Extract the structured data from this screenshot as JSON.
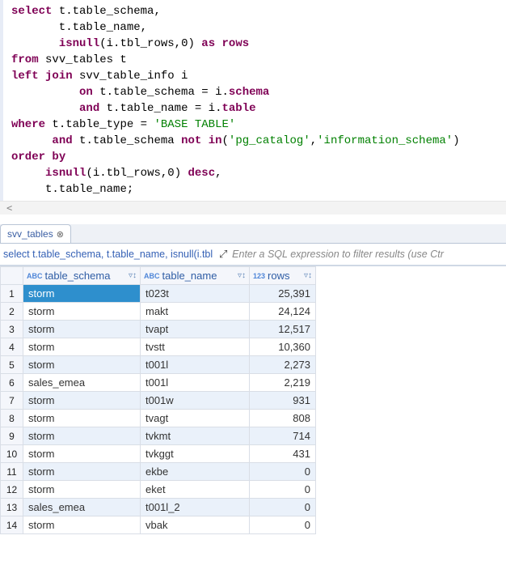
{
  "sql_tokens": [
    [
      [
        "kw",
        "select"
      ],
      [
        "pun",
        " t"
      ],
      [
        "pun",
        "."
      ],
      [
        "ident",
        "table_schema"
      ],
      [
        "pun",
        ","
      ]
    ],
    [
      [
        "pun",
        "       t"
      ],
      [
        "pun",
        "."
      ],
      [
        "ident",
        "table_name"
      ],
      [
        "pun",
        ","
      ]
    ],
    [
      [
        "pun",
        "       "
      ],
      [
        "kw",
        "isnull"
      ],
      [
        "pun",
        "(i"
      ],
      [
        "pun",
        "."
      ],
      [
        "ident",
        "tbl_rows"
      ],
      [
        "pun",
        ","
      ],
      [
        "num",
        "0"
      ],
      [
        "pun",
        ") "
      ],
      [
        "kw",
        "as"
      ],
      [
        "pun",
        " "
      ],
      [
        "kw",
        "rows"
      ]
    ],
    [
      [
        "kw",
        "from"
      ],
      [
        "pun",
        " svv_tables t"
      ]
    ],
    [
      [
        "kw",
        "left"
      ],
      [
        "pun",
        " "
      ],
      [
        "kw",
        "join"
      ],
      [
        "pun",
        " svv_table_info i"
      ]
    ],
    [
      [
        "pun",
        "          "
      ],
      [
        "kw",
        "on"
      ],
      [
        "pun",
        " t"
      ],
      [
        "pun",
        "."
      ],
      [
        "ident",
        "table_schema "
      ],
      [
        "pun",
        "= i"
      ],
      [
        "pun",
        "."
      ],
      [
        "kw",
        "schema"
      ]
    ],
    [
      [
        "pun",
        "          "
      ],
      [
        "kw",
        "and"
      ],
      [
        "pun",
        " t"
      ],
      [
        "pun",
        "."
      ],
      [
        "ident",
        "table_name "
      ],
      [
        "pun",
        "= i"
      ],
      [
        "pun",
        "."
      ],
      [
        "kw",
        "table"
      ]
    ],
    [
      [
        "kw",
        "where"
      ],
      [
        "pun",
        " t"
      ],
      [
        "pun",
        "."
      ],
      [
        "ident",
        "table_type "
      ],
      [
        "pun",
        "= "
      ],
      [
        "str",
        "'BASE TABLE'"
      ]
    ],
    [
      [
        "pun",
        "      "
      ],
      [
        "kw",
        "and"
      ],
      [
        "pun",
        " t"
      ],
      [
        "pun",
        "."
      ],
      [
        "ident",
        "table_schema "
      ],
      [
        "kw",
        "not"
      ],
      [
        "pun",
        " "
      ],
      [
        "kw",
        "in"
      ],
      [
        "pun",
        "("
      ],
      [
        "str",
        "'pg_catalog'"
      ],
      [
        "pun",
        ","
      ],
      [
        "str",
        "'information_schema'"
      ],
      [
        "pun",
        ")"
      ]
    ],
    [
      [
        "kw",
        "order"
      ],
      [
        "pun",
        " "
      ],
      [
        "kw",
        "by"
      ]
    ],
    [
      [
        "pun",
        "     "
      ],
      [
        "kw",
        "isnull"
      ],
      [
        "pun",
        "(i"
      ],
      [
        "pun",
        "."
      ],
      [
        "ident",
        "tbl_rows"
      ],
      [
        "pun",
        ","
      ],
      [
        "num",
        "0"
      ],
      [
        "pun",
        ") "
      ],
      [
        "kw",
        "desc"
      ],
      [
        "pun",
        ","
      ]
    ],
    [
      [
        "pun",
        "     t"
      ],
      [
        "pun",
        "."
      ],
      [
        "ident",
        "table_name"
      ],
      [
        "pun",
        ";"
      ]
    ]
  ],
  "tab": {
    "label": "svv_tables",
    "close_glyph": "⊗"
  },
  "filter_row": {
    "query_preview": "select t.table_schema, t.table_name, isnull(i.tbl",
    "expand_glyph": "⤢",
    "placeholder": "Enter a SQL expression to filter results (use Ctr"
  },
  "columns": [
    {
      "name": "table_schema",
      "type": "ABC",
      "type2": ""
    },
    {
      "name": "table_name",
      "type": "ABC",
      "type2": ""
    },
    {
      "name": "rows",
      "type": "123",
      "type2": ""
    }
  ],
  "chart_data": {
    "type": "table",
    "columns": [
      "table_schema",
      "table_name",
      "rows"
    ],
    "rows": [
      [
        "storm",
        "t023t",
        "25,391"
      ],
      [
        "storm",
        "makt",
        "24,124"
      ],
      [
        "storm",
        "tvapt",
        "12,517"
      ],
      [
        "storm",
        "tvstt",
        "10,360"
      ],
      [
        "storm",
        "t001l",
        "2,273"
      ],
      [
        "sales_emea",
        "t001l",
        "2,219"
      ],
      [
        "storm",
        "t001w",
        "931"
      ],
      [
        "storm",
        "tvagt",
        "808"
      ],
      [
        "storm",
        "tvkmt",
        "714"
      ],
      [
        "storm",
        "tvkggt",
        "431"
      ],
      [
        "storm",
        "ekbe",
        "0"
      ],
      [
        "storm",
        "eket",
        "0"
      ],
      [
        "sales_emea",
        "t001l_2",
        "0"
      ],
      [
        "storm",
        "vbak",
        "0"
      ]
    ],
    "selected_row_index": 0
  },
  "funnel_glyph": "▾",
  "scroll_glyph": "<"
}
